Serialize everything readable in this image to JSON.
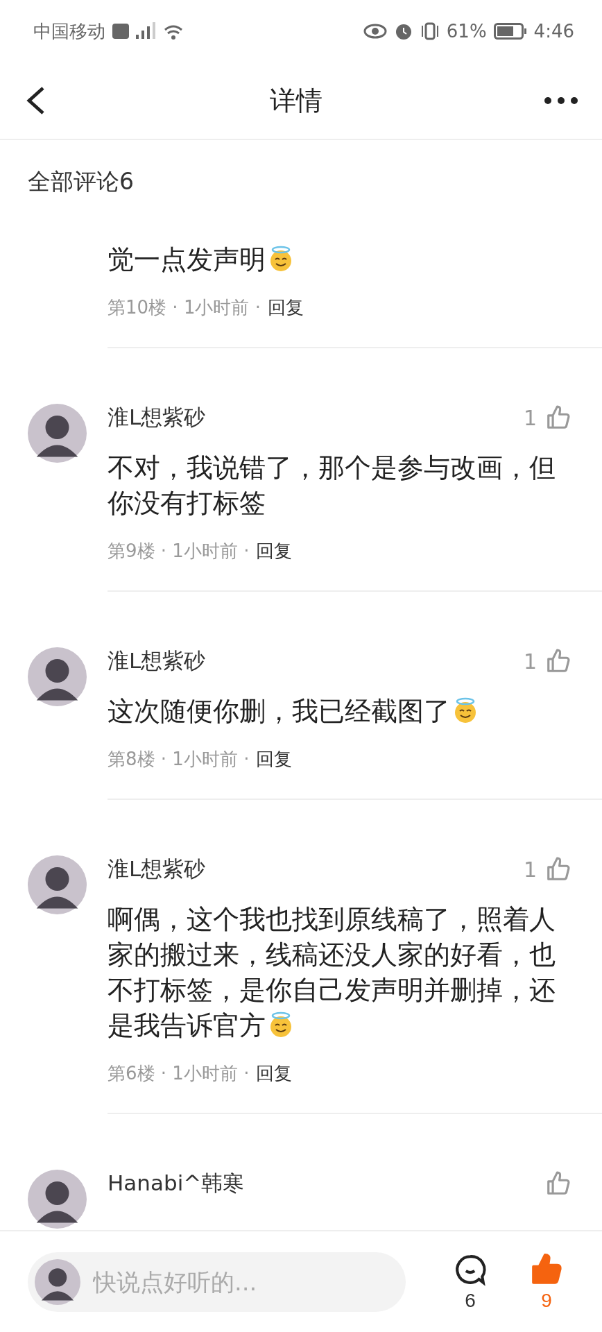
{
  "status_bar": {
    "carrier": "中国移动",
    "battery": "61%",
    "time": "4:46"
  },
  "header": {
    "title": "详情"
  },
  "comments_header": {
    "title": "全部评论6"
  },
  "comments": [
    {
      "partial": true,
      "text": "觉一点发声明",
      "emoji": true,
      "meta": "第10楼 · 1小时前 ·",
      "reply": "回复"
    },
    {
      "partial": false,
      "name": "淮L想紫砂",
      "likes": "1",
      "text": "不对，我说错了，那个是参与改画，但你没有打标签",
      "emoji": false,
      "meta": "第9楼 · 1小时前 ·",
      "reply": "回复"
    },
    {
      "partial": false,
      "name": "淮L想紫砂",
      "likes": "1",
      "text": "这次随便你删，我已经截图了",
      "emoji": true,
      "meta": "第8楼 · 1小时前 ·",
      "reply": "回复"
    },
    {
      "partial": false,
      "name": "淮L想紫砂",
      "likes": "1",
      "text": "啊偶，这个我也找到原线稿了，照着人家的搬过来，线稿还没人家的好看，也不打标签，是你自己发声明并删掉，还是我告诉官方",
      "emoji": true,
      "meta": "第6楼 · 1小时前 ·",
      "reply": "回复"
    },
    {
      "partial": false,
      "name": "Hanabi^韩寒"
    }
  ],
  "bottom_bar": {
    "placeholder": "快说点好听的...",
    "comment_count": "6",
    "like_count": "9",
    "liked": true
  }
}
